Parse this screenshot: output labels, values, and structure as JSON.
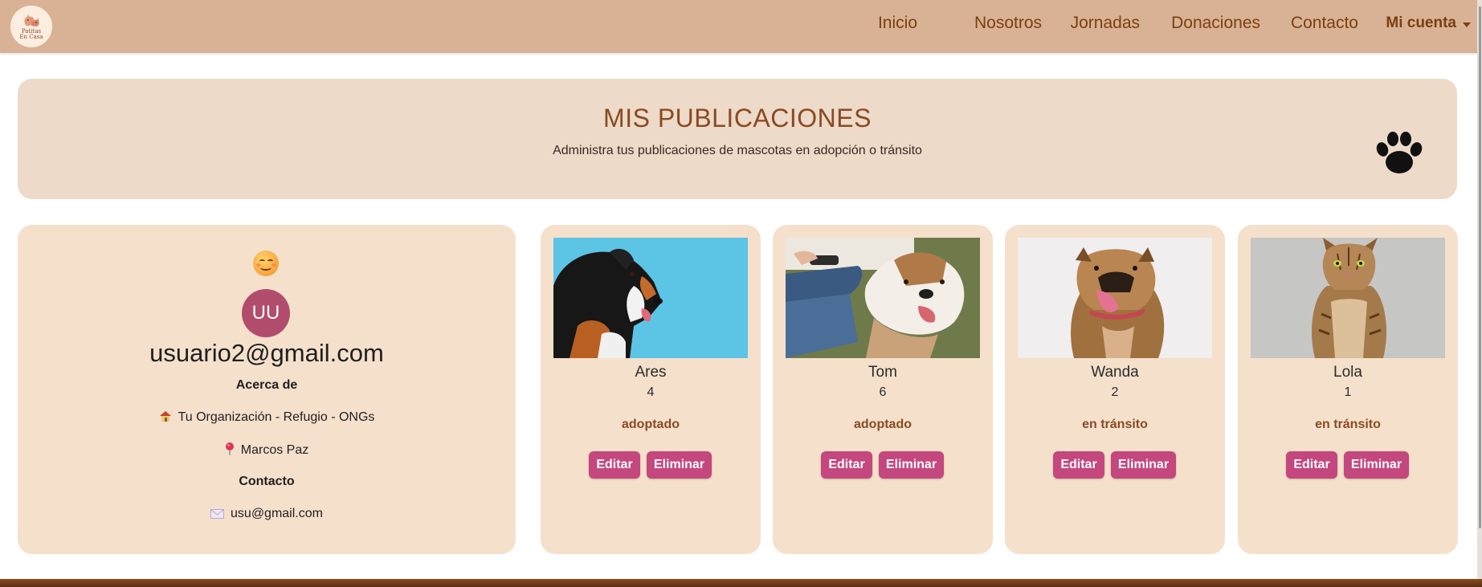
{
  "navbar": {
    "logo_text_1": "Patitas",
    "logo_text_2": "En Casa",
    "links": [
      "Inicio",
      "Nosotros",
      "Jornadas",
      "Donaciones",
      "Contacto"
    ],
    "account_label": "Mi cuenta"
  },
  "banner": {
    "title": "MIS PUBLICACIONES",
    "subtitle": "Administra tus publicaciones de mascotas en adopción o tránsito"
  },
  "profile": {
    "avatar_initials": "UU",
    "email": "usuario2@gmail.com",
    "about_heading": "Acerca de",
    "organization": "Tu Organización - Refugio - ONGs",
    "location": "Marcos Paz",
    "contact_heading": "Contacto",
    "contact_email": "usu@gmail.com"
  },
  "pets": [
    {
      "name": "Ares",
      "age": "4",
      "status": "adoptado"
    },
    {
      "name": "Tom",
      "age": "6",
      "status": "adoptado"
    },
    {
      "name": "Wanda",
      "age": "2",
      "status": "en tránsito"
    },
    {
      "name": "Lola",
      "age": "1",
      "status": "en tránsito"
    }
  ],
  "buttons": {
    "edit_label": "Editar",
    "delete_label": "Eliminar"
  },
  "colors": {
    "navbar": "#d9b295",
    "card": "#f5e0cc",
    "banner": "#eddac9",
    "accent_button": "#c4477d",
    "nav_text": "#7a3f10",
    "status_text": "#8a4a22",
    "avatar": "#b24c6c"
  },
  "icons": {
    "logo": "cat-dog-logo",
    "banner": "paw-icon",
    "profile": "smiling-face-icon",
    "organization": "house-icon",
    "location": "pin-icon",
    "contact": "envelope-icon"
  }
}
